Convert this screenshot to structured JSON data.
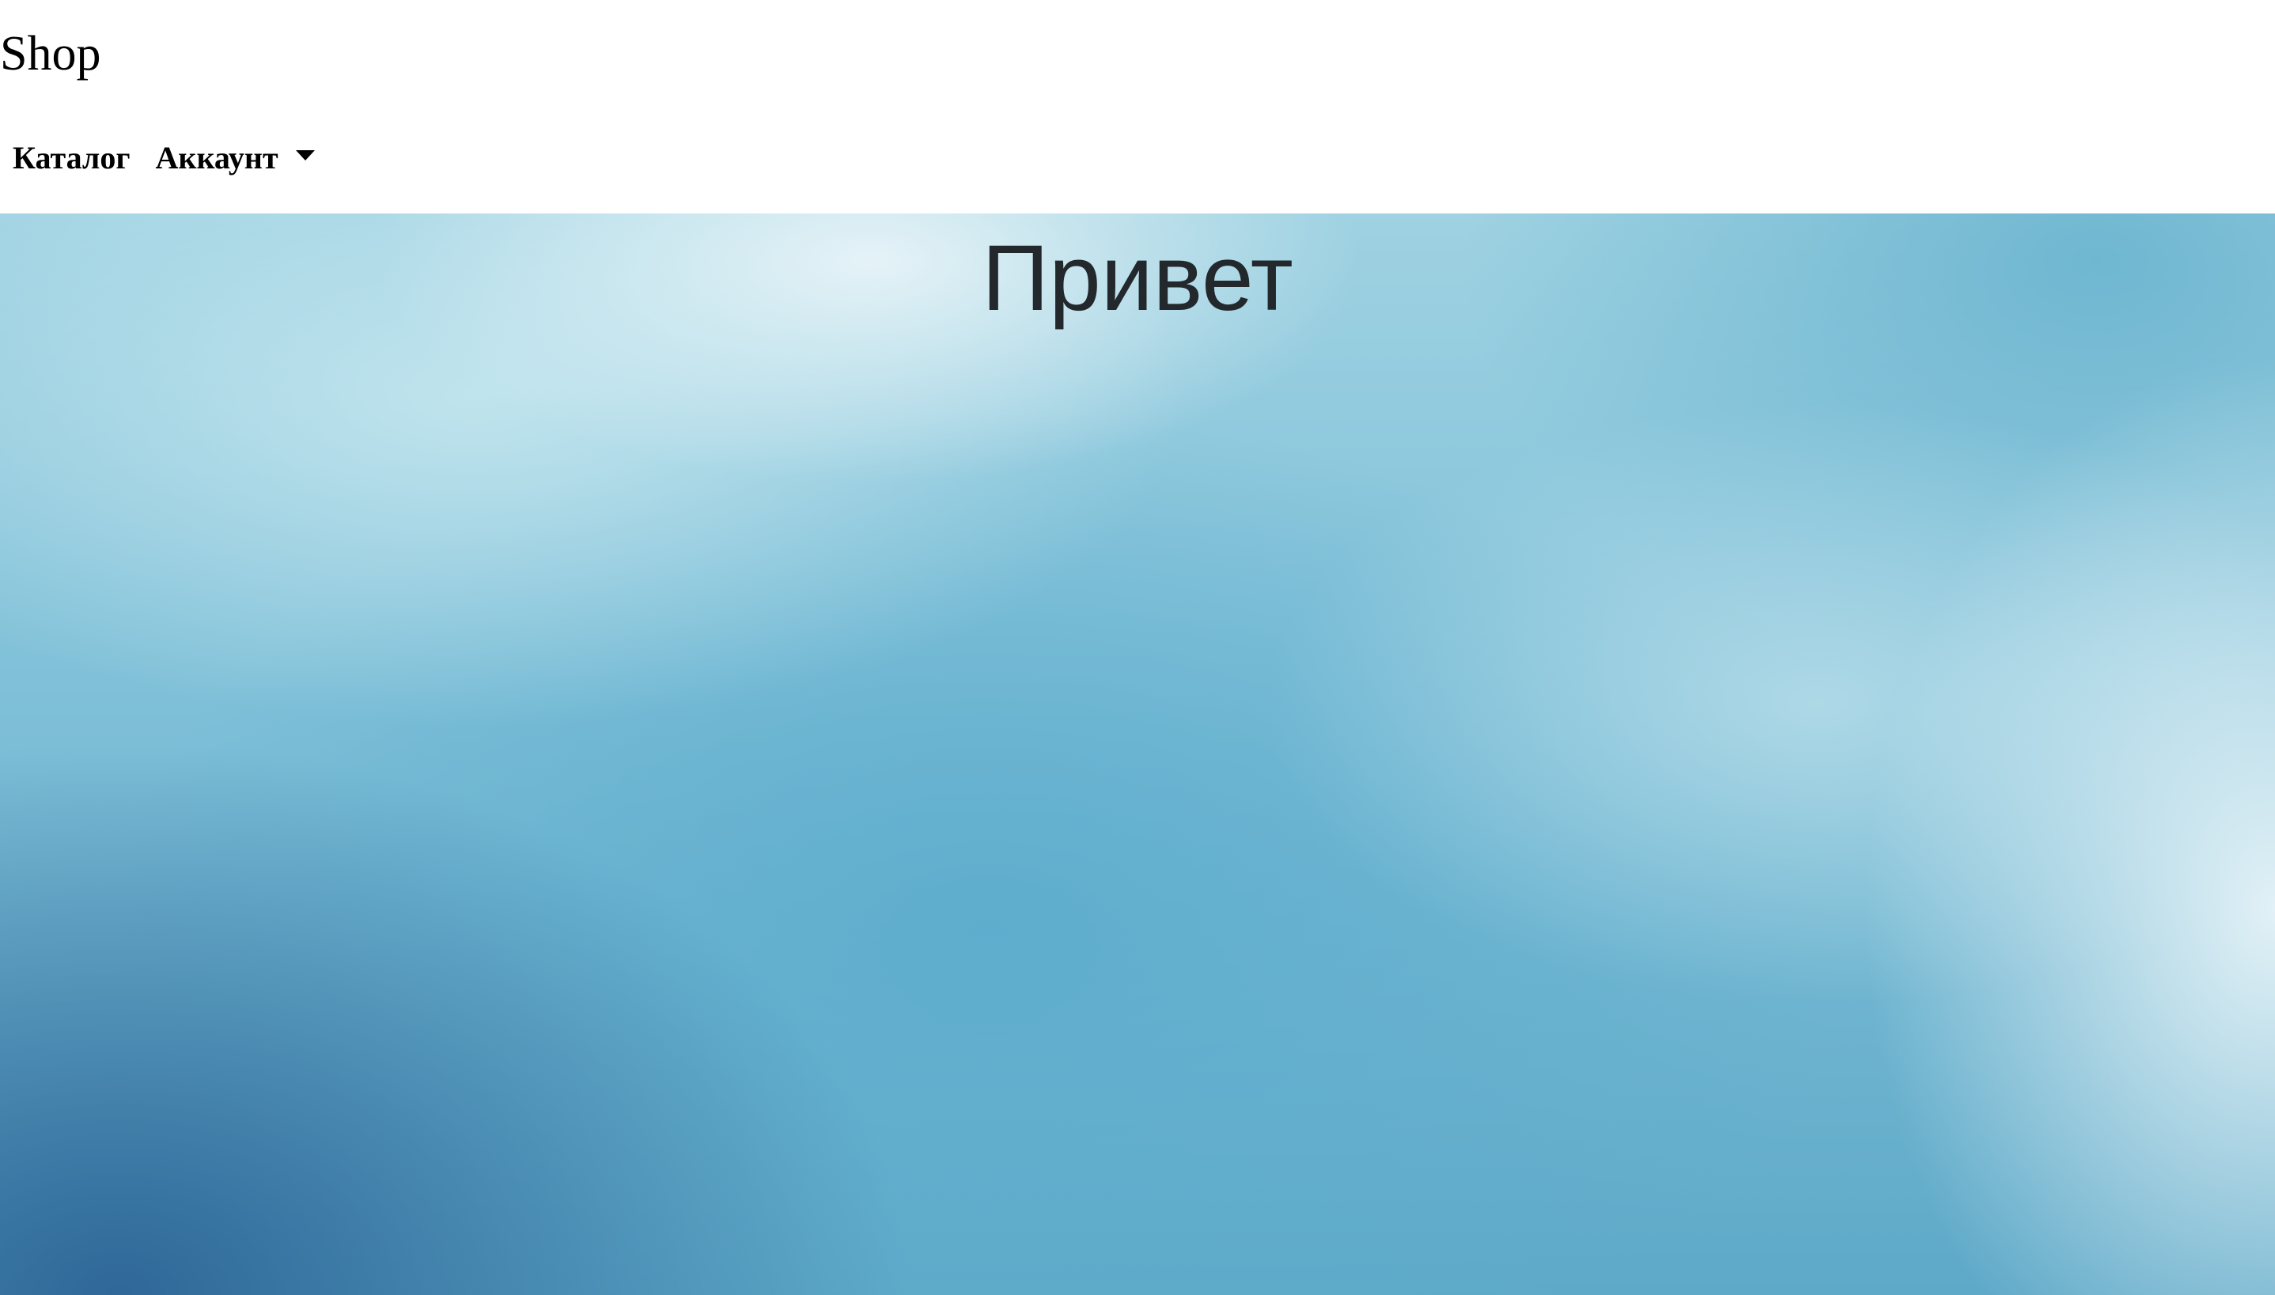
{
  "header": {
    "brand": "Shop",
    "nav": {
      "catalog_label": "Каталог",
      "account_label": "Аккаунт"
    }
  },
  "hero": {
    "title": "Привет"
  },
  "colors": {
    "header_background": "#ffffff",
    "text": "#000000",
    "hero_title": "#23282c",
    "hero_light": "#d9eef4",
    "hero_mid": "#5fb0cd",
    "hero_dark": "#2c6496"
  },
  "icons": {
    "account_dropdown": "caret-down-icon"
  }
}
